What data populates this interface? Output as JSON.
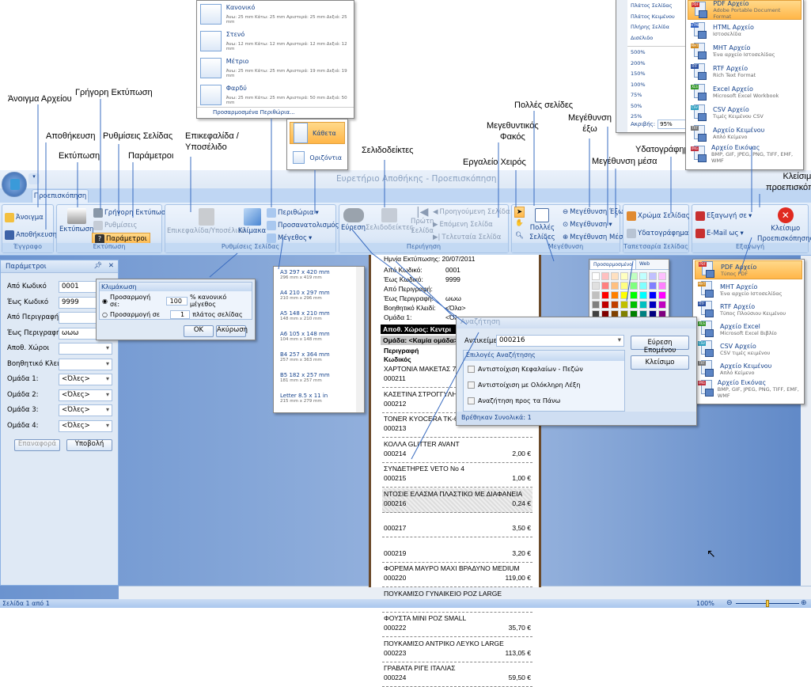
{
  "window_title": "Ευρετήριο Αποθήκης - Προεπισκόπηση",
  "tab": "Προεπισκόπηση",
  "annotations": {
    "open_file": "Άνοιγμα Αρχείου",
    "save": "Αποθήκευση",
    "print": "Εκτύπωση",
    "quick_print": "Γρήγορη Εκτύπωση",
    "page_setup": "Ρυθμίσεις Σελίδας",
    "parameters": "Παράμετροι",
    "header_footer_1": "Επικεφαλίδα /",
    "header_footer_2": "Υποσέλιδο",
    "bookmarks": "Σελιδοδείκτες",
    "hand_tool": "Εργαλείο Χειρός",
    "magnifier_1": "Μεγεθυντικός",
    "magnifier_2": "Φακός",
    "multiple_pages": "Πολλές σελίδες",
    "zoom_out_1": "Μεγέθυνση",
    "zoom_out_2": "έξω",
    "zoom_in": "Μεγέθυνση μέσα",
    "watermark": "Υδατογράφημα",
    "close_preview_1": "Κλείσιμο",
    "close_preview_2": "προεπισκόπησης"
  },
  "ribbon": {
    "document": {
      "label": "Έγγραφο",
      "open": "Άνοιγμα",
      "save": "Αποθήκευση"
    },
    "print": {
      "label": "Εκτύπωση",
      "print": "Εκτύπωση",
      "quick_print": "Γρήγορη Εκτύπωση",
      "settings": "Ρυθμίσεις",
      "parameters": "Παράμετροι"
    },
    "page_setup": {
      "label": "Ρυθμίσεις Σελίδας",
      "header_footer": "Επικεφαλίδα/Υποσέλιδο",
      "scale": "Κλίμακα",
      "margins": "Περιθώρια",
      "orientation": "Προσανατολισμός",
      "size": "Μέγεθος"
    },
    "navigation": {
      "label": "Περιήγηση",
      "find": "Εύρεση",
      "bookmarks": "Σελιδοδείκτες",
      "first_page_1": "Πρώτη",
      "first_page_2": "Σελίδα",
      "prev": "Προηγούμενη Σελίδα",
      "next": "Επόμενη Σελίδα",
      "last": "Τελευταία Σελίδα"
    },
    "zoom": {
      "label": "Μεγέθυνση",
      "many_pages_1": "Πολλές",
      "many_pages_2": "Σελίδες",
      "zoom_out": "Μεγέθυνση Έξω",
      "zoom": "Μεγέθυνση",
      "zoom_in": "Μεγέθυνση Μέσα"
    },
    "background": {
      "label": "Ταπετσαρία Σελίδας",
      "page_color": "Χρώμα Σελίδας",
      "watermark": "Υδατογράφημα"
    },
    "export": {
      "label": "Εξαγωγή",
      "export_to": "Εξαγωγή σε",
      "email_as": "E-Mail ως",
      "close_1": "Κλείσιμο",
      "close_2": "Προεπισκόπησης"
    }
  },
  "margins_menu": {
    "items": [
      {
        "title": "Κανονικό",
        "desc": "Άνω: 25 mm Κάτω: 25 mm Αριστερά: 25 mm Δεξιά: 25 mm"
      },
      {
        "title": "Στενό",
        "desc": "Άνω: 12 mm Κάτω: 12 mm Αριστερά: 12 mm Δεξιά: 12 mm"
      },
      {
        "title": "Μέτριο",
        "desc": "Άνω: 25 mm Κάτω: 25 mm Αριστερά: 19 mm Δεξιά: 19 mm"
      },
      {
        "title": "Φαρδύ",
        "desc": "Άνω: 25 mm Κάτω: 25 mm Αριστερά: 50 mm Δεξιά: 50 mm"
      }
    ],
    "custom": "Προσαρμοσμένα Περιθώρια..."
  },
  "orientation_menu": {
    "portrait": "Κάθετα",
    "landscape": "Οριζόντια",
    "selected": "Κάθετα"
  },
  "zoom_menu": {
    "fit": [
      "Πλάτος Σελίδας",
      "Πλάτος Κειμένου",
      "Πλήρης Σελίδα",
      "Δισέλιδο"
    ],
    "levels": [
      "500%",
      "200%",
      "150%",
      "100%",
      "75%",
      "50%",
      "25%"
    ],
    "exact_label": "Ακριβής:",
    "exact_value": "95%"
  },
  "export_menu": [
    {
      "title": "PDF Αρχείο",
      "desc": "Adobe Portable Document Format",
      "badge": "PDF",
      "color": "#d03030"
    },
    {
      "title": "HTML Αρχείο",
      "desc": "Ιστοσελίδα",
      "badge": "HTML",
      "color": "#3060c0"
    },
    {
      "title": "MHT Αρχείο",
      "desc": "Ένα αρχείο Ιστοσελίδας",
      "badge": "MHT",
      "color": "#d08a20"
    },
    {
      "title": "RTF Αρχείο",
      "desc": "Rich Text Format",
      "badge": "RTF",
      "color": "#2a4fa0"
    },
    {
      "title": "Excel Αρχείο",
      "desc": "Microsoft Excel Workbook",
      "badge": "XLS",
      "color": "#3a9a30"
    },
    {
      "title": "CSV Αρχείο",
      "desc": "Τιμές Κειμένου CSV",
      "badge": "CSV",
      "color": "#30a0c0"
    },
    {
      "title": "Αρχείο Κειμένου",
      "desc": "Απλό Κείμενο",
      "badge": "TXT",
      "color": "#777777"
    },
    {
      "title": "Αρχείο Εικόνας",
      "desc": "BMP, GIF, JPEG, PNG, TIFF, EMF, WMF",
      "badge": "IMG",
      "color": "#c03040"
    }
  ],
  "email_menu": [
    {
      "title": "PDF Αρχείο",
      "desc": "Τύπος PDF",
      "badge": "PDF",
      "color": "#d03030"
    },
    {
      "title": "MHT Αρχείο",
      "desc": "Ένα αρχείο Ιστοσελίδας",
      "badge": "MHT",
      "color": "#d08a20"
    },
    {
      "title": "RTF Αρχείο",
      "desc": "Τύπος Πλούσιου Κειμένου",
      "badge": "RTF",
      "color": "#2a4fa0"
    },
    {
      "title": "Αρχείο Excel",
      "desc": "Microsoft Excel Βιβλίο",
      "badge": "XLS",
      "color": "#3a9a30"
    },
    {
      "title": "CSV Αρχείο",
      "desc": "CSV τιμές κειμένου",
      "badge": "CSV",
      "color": "#30a0c0"
    },
    {
      "title": "Αρχείο Κειμένου",
      "desc": "Απλό Κείμενο",
      "badge": "TXT",
      "color": "#777777"
    },
    {
      "title": "Αρχείο Εικόνας",
      "desc": "BMP, GIF, JPEG, PNG, TIFF, EMF, WMF",
      "badge": "IMG",
      "color": "#c03040"
    }
  ],
  "paper_sizes": [
    {
      "title": "A3 297 x 420 mm",
      "desc": "296 mm x 419 mm"
    },
    {
      "title": "A4 210 x 297 mm",
      "desc": "210 mm x 296 mm"
    },
    {
      "title": "A5 148 x 210 mm",
      "desc": "148 mm x 210 mm"
    },
    {
      "title": "A6 105 x 148 mm",
      "desc": "104 mm x 148 mm"
    },
    {
      "title": "B4 257 x 364 mm",
      "desc": "257 mm x 363 mm"
    },
    {
      "title": "B5 182 x 257 mm",
      "desc": "181 mm x 257 mm"
    },
    {
      "title": "Letter 8.5 x 11 in",
      "desc": "215 mm x 279 mm"
    }
  ],
  "params_panel": {
    "title": "Παράμετροι",
    "fields": [
      {
        "label": "Από Κωδικό",
        "value": "0001",
        "dropdown": false
      },
      {
        "label": "Έως Κωδικό",
        "value": "9999",
        "dropdown": false
      },
      {
        "label": "Από Περιγραφή",
        "value": "",
        "dropdown": false
      },
      {
        "label": "Έως Περιγραφή",
        "value": "ωωω",
        "dropdown": false
      },
      {
        "label": "Αποθ. Χώροι",
        "value": "",
        "dropdown": true
      },
      {
        "label": "Βοηθητικό Κλειδί:",
        "value": "",
        "dropdown": true
      },
      {
        "label": "Ομάδα 1:",
        "value": "<Όλες>",
        "dropdown": true
      },
      {
        "label": "Ομάδα 2:",
        "value": "<Όλες>",
        "dropdown": true
      },
      {
        "label": "Ομάδα 3:",
        "value": "<Όλες>",
        "dropdown": true
      },
      {
        "label": "Ομάδα 4:",
        "value": "<Όλες>",
        "dropdown": true
      }
    ],
    "reset": "Επαναφορά",
    "submit": "Υποβολή"
  },
  "scaling_dialog": {
    "title": "Κλιμάκωση",
    "opt1": "Προσαρμογή σε:",
    "opt1_value": "100",
    "opt1_unit": "% κανονικό μέγεθος",
    "opt2": "Προσαρμογή σε",
    "opt2_value": "1",
    "opt2_unit": "πλάτος σελίδας",
    "ok": "OK",
    "cancel": "Ακύρωση"
  },
  "color_picker": {
    "tabs": [
      "Προσαρμοσμένο",
      "Web"
    ],
    "colors": [
      "#ffffff",
      "#ffc0c0",
      "#ffe0c0",
      "#ffffc0",
      "#c0ffc0",
      "#c0ffff",
      "#c0c0ff",
      "#ffc0ff",
      "#e0e0e0",
      "#ff8080",
      "#ffc080",
      "#ffff80",
      "#80ff80",
      "#80ffff",
      "#8080ff",
      "#ff80ff",
      "#c0c0c0",
      "#ff0000",
      "#ff8000",
      "#ffff00",
      "#00ff00",
      "#00ffff",
      "#0000ff",
      "#ff00ff",
      "#808080",
      "#c00000",
      "#c04000",
      "#c0c000",
      "#00c000",
      "#00c0c0",
      "#0000c0",
      "#c000c0",
      "#404040",
      "#800000",
      "#804000",
      "#808000",
      "#008000",
      "#008080",
      "#000080",
      "#800080",
      "#000000",
      "#400000",
      "#804040",
      "#404000",
      "#004000",
      "#004040",
      "#000040",
      "#400040"
    ]
  },
  "search_dialog": {
    "title": "Αναζήτηση",
    "find_label": "Αντικείμε",
    "find_value": "000216",
    "options_title": "Επιλογές Αναζήτησης",
    "options": [
      "Αντιστοίχιση Κεφαλαίων - Πεζών",
      "Αντιστοίχιση με Ολόκληρη Λέξη",
      "Αναζήτηση προς τα  Πάνω"
    ],
    "find_next": "Εύρεση Επομένου",
    "close": "Κλείσιμο",
    "result": "Βρέθηκαν Συνολικά: 1"
  },
  "report": {
    "print_date": "Ημνία Εκτύπωσης:  20/07/2011",
    "header": [
      [
        "Από Κωδικό:",
        "0001"
      ],
      [
        "Έως Κωδικό:",
        "9999"
      ],
      [
        "Από Περιγραφή:",
        ""
      ],
      [
        "Έως Περιγραφή:",
        "ωωω"
      ],
      [
        "Βοηθητικό Κλειδί:",
        "<Όλα>"
      ],
      [
        "Ομάδα 1:",
        "<Όλ"
      ]
    ],
    "warehouse": "Αποθ. Χώρος:  Κεντρι",
    "group": "Ομάδα: <Καμία ομάδα>",
    "col_desc": "Περιγραφή",
    "col_code": "Κωδικός",
    "items": [
      {
        "desc": "ΧΑΡΤΟΝΙΑ ΜΑΚΕΤΑΣ 70Χ",
        "code": "000211",
        "price": ""
      },
      {
        "desc": "ΚΑΣΕΤΙΝΑ ΣΤΡΟΓΓΥΛΗ Μ",
        "code": "000212",
        "price": ""
      },
      {
        "desc": "TONER KYOCERA TK-603",
        "code": "000213",
        "price": ""
      },
      {
        "desc": "ΚΟΛΛΑ GLITTER AVANT",
        "code": "000214",
        "price": "2,00 €"
      },
      {
        "desc": "ΣΥΝΔΕΤΗΡΕΣ VETO No 4",
        "code": "000215",
        "price": "1,00 €"
      },
      {
        "desc": "ΝΤΟΣΙΕ ΕΛΑΣΜΑ ΠΛΑΣΤΙΚΟ ΜΕ ΔΙΑΦΑΝΕΙΑ",
        "code": "000216",
        "price": "0,24 €"
      },
      {
        "desc": "",
        "code": "000217",
        "price": "3,50 €"
      },
      {
        "desc": "",
        "code": "000219",
        "price": "3,20 €"
      },
      {
        "desc": "ΦΟΡΕΜΑ ΜΑΥΡΟ ΜΑΧΙ ΒΡΑΔΥΝΟ MEDIUM",
        "code": "000220",
        "price": "119,00 €"
      },
      {
        "desc": "ΠΟΥΚΑΜΙΣΟ ΓΥΝΑΙΚΕΙΟ ΡΟΖ LARGE",
        "code": "000221",
        "price": "59,50 €"
      },
      {
        "desc": "ΦΟΥΣΤΑ ΜΙΝΙ ΡΟΖ SMALL",
        "code": "000222",
        "price": "35,70 €"
      },
      {
        "desc": "ΠΟΥΚΑΜΙΣΟ ΑΝΤΡΙΚΟ ΛΕΥΚΟ LARGE",
        "code": "000223",
        "price": "113,05 €"
      },
      {
        "desc": "ΓΡΑΒΑΤΑ ΡΙΓΕ ΙΤΑΛΙΑΣ",
        "code": "000224",
        "price": "59,50 €"
      }
    ]
  },
  "status": {
    "page": "Σελίδα 1 από 1",
    "zoom": "100%",
    "zoom_value": 100
  }
}
